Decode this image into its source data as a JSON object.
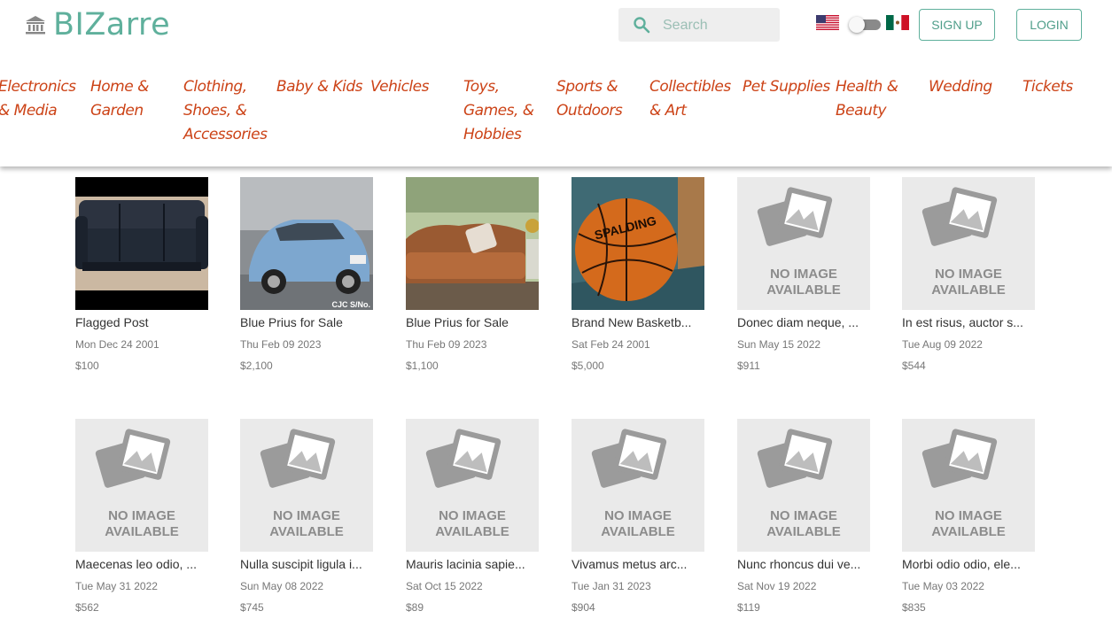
{
  "brand": {
    "name": "BIZarre",
    "accent": "#5fb09c",
    "category_color": "#cc4317"
  },
  "search": {
    "placeholder": "Search"
  },
  "auth": {
    "signup": "SIGN UP",
    "login": "LOGIN"
  },
  "categories": [
    [
      "Electronics",
      "& Media"
    ],
    [
      "Home &",
      "Garden"
    ],
    [
      "Clothing,",
      "Shoes, &",
      "Accessories"
    ],
    [
      "Baby & Kids"
    ],
    [
      "Vehicles"
    ],
    [
      "Toys,",
      "Games, &",
      "Hobbies"
    ],
    [
      "Sports &",
      "Outdoors"
    ],
    [
      "Collectibles",
      "& Art"
    ],
    [
      "Pet Supplies"
    ],
    [
      "Health &",
      "Beauty"
    ],
    [
      "Wedding"
    ],
    [
      "Tickets"
    ]
  ],
  "no_image_text": [
    "NO IMAGE",
    "AVAILABLE"
  ],
  "listings": [
    {
      "title": "Flagged Post",
      "date": "Mon Dec 24 2001",
      "price": "$100",
      "image": "leather-sofa"
    },
    {
      "title": "Blue Prius for Sale",
      "date": "Thu Feb 09 2023",
      "price": "$2,100",
      "image": "blue-car",
      "image_caption": "CJC S/No."
    },
    {
      "title": "Blue Prius for Sale",
      "date": "Thu Feb 09 2023",
      "price": "$1,100",
      "image": "brown-couch"
    },
    {
      "title": "Brand New Basketb...",
      "date": "Sat Feb 24 2001",
      "price": "$5,000",
      "image": "basketball",
      "image_caption": "SPALDING"
    },
    {
      "title": "Donec diam neque, ...",
      "date": "Sun May 15 2022",
      "price": "$911",
      "image": "none"
    },
    {
      "title": "In est risus, auctor s...",
      "date": "Tue Aug 09 2022",
      "price": "$544",
      "image": "none"
    },
    {
      "title": "Maecenas leo odio, ...",
      "date": "Tue May 31 2022",
      "price": "$562",
      "image": "none"
    },
    {
      "title": "Nulla suscipit ligula i...",
      "date": "Sun May 08 2022",
      "price": "$745",
      "image": "none"
    },
    {
      "title": "Mauris lacinia sapie...",
      "date": "Sat Oct 15 2022",
      "price": "$89",
      "image": "none"
    },
    {
      "title": "Vivamus metus arc...",
      "date": "Tue Jan 31 2023",
      "price": "$904",
      "image": "none"
    },
    {
      "title": "Nunc rhoncus dui ve...",
      "date": "Sat Nov 19 2022",
      "price": "$119",
      "image": "none"
    },
    {
      "title": "Morbi odio odio, ele...",
      "date": "Tue May 03 2022",
      "price": "$835",
      "image": "none"
    }
  ]
}
